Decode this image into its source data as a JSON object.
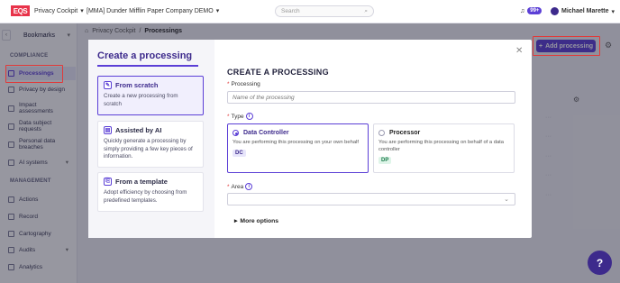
{
  "topbar": {
    "logo": "EQS",
    "app_name": "Privacy Cockpit",
    "company": "[MMA] Dunder Mifflin Paper Company DEMO",
    "search_placeholder": "Search",
    "notification_count": "99+",
    "user_name": "Michael Marette"
  },
  "sidebar": {
    "bookmarks": "Bookmarks",
    "sections": [
      {
        "label": "COMPLIANCE"
      },
      {
        "label": "MANAGEMENT"
      }
    ],
    "items": [
      {
        "label": "Processings"
      },
      {
        "label": "Privacy by design"
      },
      {
        "label": "Impact assessments"
      },
      {
        "label": "Data subject requests"
      },
      {
        "label": "Personal data breaches"
      },
      {
        "label": "AI systems"
      },
      {
        "label": "Actions"
      },
      {
        "label": "Record"
      },
      {
        "label": "Cartography"
      },
      {
        "label": "Audits"
      },
      {
        "label": "Analytics"
      }
    ]
  },
  "breadcrumb": {
    "root": "Privacy Cockpit",
    "sep": "/",
    "current": "Processings"
  },
  "header": {
    "add_button": "Add processing"
  },
  "modal": {
    "title": "Create a processing",
    "options": [
      {
        "title": "From scratch",
        "desc": "Create a new processing from scratch"
      },
      {
        "title": "Assisted by AI",
        "desc": "Quickly generate a processing by simply providing a few key pieces of information."
      },
      {
        "title": "From a template",
        "desc": "Adopt efficiency by choosing from predefined templates."
      }
    ],
    "heading": "CREATE A PROCESSING",
    "processing_label": "Processing",
    "processing_placeholder": "Name of the processing",
    "type_label": "Type",
    "types": [
      {
        "title": "Data Controller",
        "desc": "You are performing this processing on your own behalf",
        "tag": "DC"
      },
      {
        "title": "Processor",
        "desc": "You are performing this processing on behalf of a data controller",
        "tag": "DP"
      }
    ],
    "area_label": "Area",
    "more_options": "More options",
    "required_mark": "*",
    "info_mark": "i"
  },
  "accent_color": "#5b3fd6"
}
